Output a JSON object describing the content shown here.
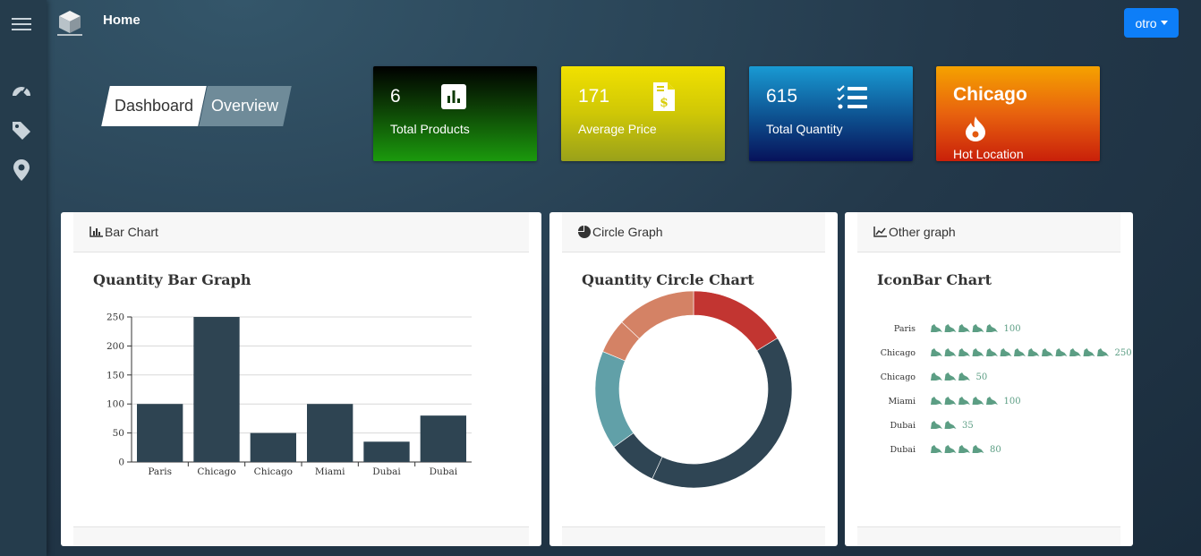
{
  "header": {
    "title": "Home",
    "menu_button": "otro"
  },
  "sidebar": {
    "icons": [
      "hamburger-icon",
      "speedometer-icon",
      "tags-icon",
      "map-marker-icon"
    ]
  },
  "tabs": {
    "dashboard": "Dashboard",
    "overview": "Overview"
  },
  "stats": [
    {
      "value": "6",
      "label": "Total Products",
      "icon": "bar-chart-icon"
    },
    {
      "value": "171",
      "label": "Average Price",
      "icon": "invoice-dollar-icon"
    },
    {
      "value": "615",
      "label": "Total Quantity",
      "icon": "checklist-icon"
    },
    {
      "value": "Chicago",
      "label": "Hot Location",
      "icon": "fire-icon"
    }
  ],
  "cards": {
    "bar": {
      "header": "Bar Chart",
      "title": "Quantity Bar Graph"
    },
    "circle": {
      "header": "Circle Graph",
      "title": "Quantity Circle Chart"
    },
    "other": {
      "header": "Other graph",
      "title": "IconBar Chart"
    }
  },
  "chart_data": [
    {
      "type": "bar",
      "title": "Quantity Bar Graph",
      "categories": [
        "Paris",
        "Chicago",
        "Chicago",
        "Miami",
        "Dubai",
        "Dubai"
      ],
      "values": [
        100,
        250,
        50,
        100,
        35,
        80
      ],
      "ylim": [
        0,
        250
      ],
      "yticks": [
        0,
        50,
        100,
        150,
        200,
        250
      ],
      "grid": true,
      "color": "#2e4452"
    },
    {
      "type": "pie",
      "title": "Quantity Circle Chart",
      "donut": true,
      "values": [
        100,
        250,
        50,
        100,
        35,
        80
      ],
      "colors": [
        "#c23531",
        "#2f4554",
        "#2f4554",
        "#61a0a8",
        "#d48265",
        "#d48265"
      ]
    },
    {
      "type": "bar",
      "title": "IconBar Chart",
      "categories": [
        "Paris",
        "Chicago",
        "Chicago",
        "Miami",
        "Dubai",
        "Dubai"
      ],
      "values": [
        100,
        250,
        50,
        100,
        35,
        80
      ],
      "value_labels": [
        "100",
        "250",
        "50",
        "100",
        "35",
        "80"
      ],
      "color": "#5c9e84"
    }
  ]
}
